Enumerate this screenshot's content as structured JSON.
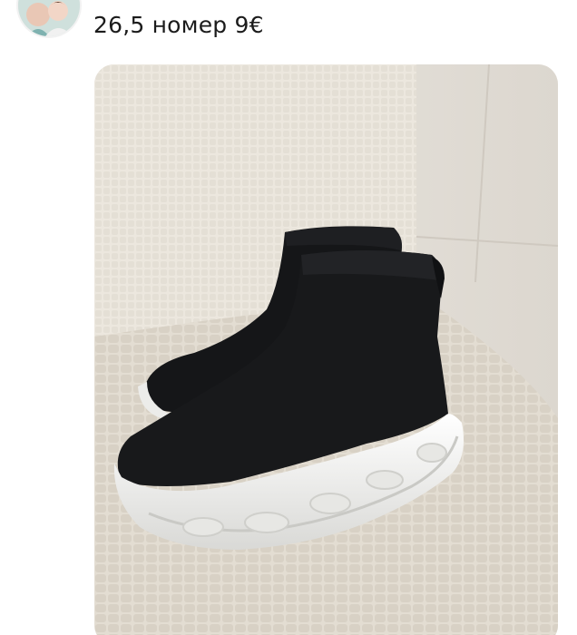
{
  "post": {
    "caption": "26,5 номер 9€",
    "avatar_icon": "user-avatar-icon",
    "photo_subject": "photo-image"
  },
  "colors": {
    "background": "#ffffff",
    "caption_text": "#1b1b1b",
    "wall": "#ece7de",
    "tile": "#e2ddd3",
    "shoe_knit": "#18191b",
    "sole": "#f4f4f2"
  }
}
